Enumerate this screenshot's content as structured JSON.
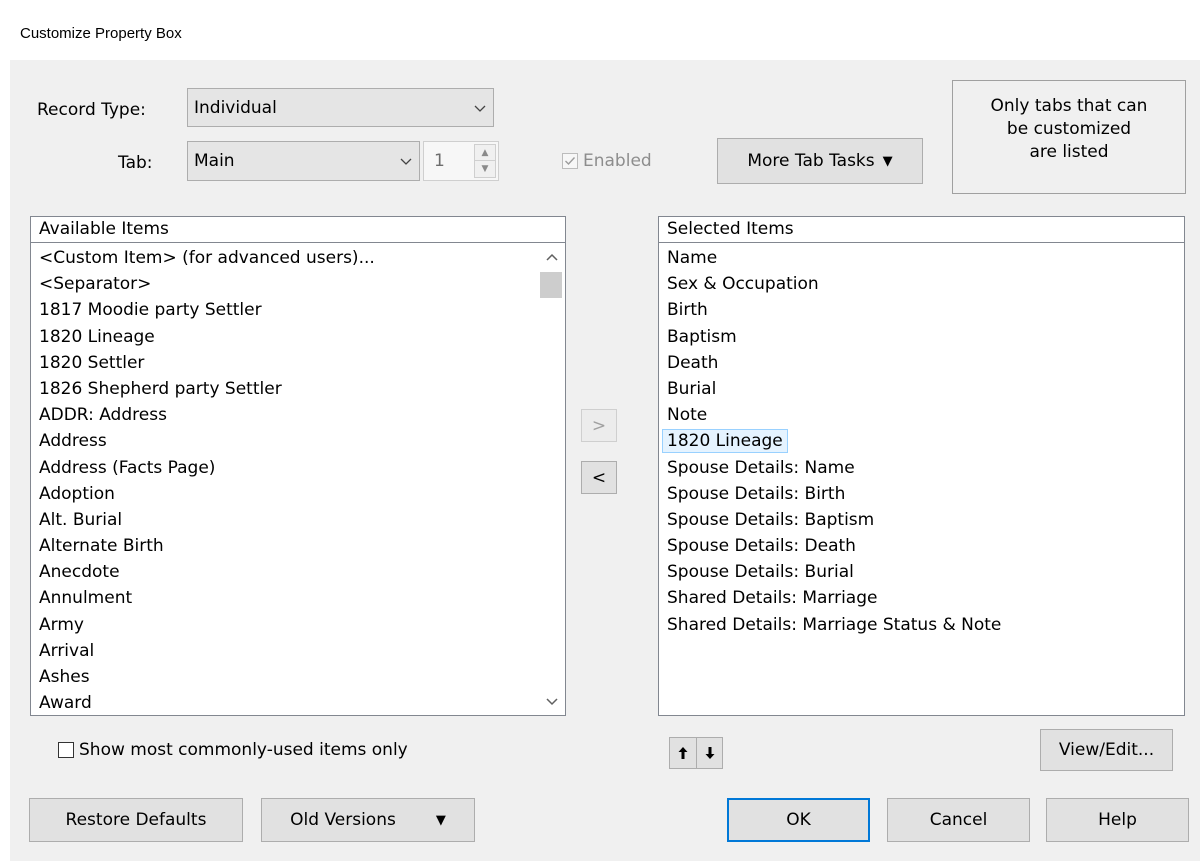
{
  "window": {
    "title": "Customize Property Box"
  },
  "record_type": {
    "label": "Record Type:",
    "value": "Individual"
  },
  "tab": {
    "label": "Tab:",
    "value": "Main",
    "spinner_value": "1"
  },
  "enabled": {
    "label": "Enabled",
    "checked": true,
    "disabled": true
  },
  "more_tab_tasks": {
    "label": "More Tab Tasks"
  },
  "info_note": {
    "line1": "Only tabs that can",
    "line2": "be customized",
    "line3": "are listed"
  },
  "available": {
    "header": "Available Items",
    "items": [
      "<Custom Item> (for advanced users)...",
      "<Separator>",
      "1817 Moodie party Settler",
      "1820 Lineage",
      "1820 Settler",
      "1826 Shepherd party Settler",
      "ADDR: Address",
      "Address",
      "Address (Facts Page)",
      "Adoption",
      "Alt. Burial",
      "Alternate Birth",
      "Anecdote",
      "Annulment",
      "Army",
      "Arrival",
      "Ashes",
      "Award"
    ]
  },
  "move_buttons": {
    "add": ">",
    "remove": "<"
  },
  "selected": {
    "header": "Selected Items",
    "items": [
      "Name",
      "Sex & Occupation",
      "Birth",
      "Baptism",
      "Death",
      "Burial",
      "Note",
      "1820 Lineage",
      "Spouse Details: Name",
      "Spouse Details: Birth",
      "Spouse Details: Baptism",
      "Spouse Details: Death",
      "Spouse Details: Burial",
      "Shared Details: Marriage",
      "Shared Details: Marriage Status & Note"
    ],
    "selected_item": "1820 Lineage"
  },
  "common_only": {
    "label": "Show most commonly-used items only",
    "checked": false
  },
  "buttons": {
    "view_edit": "View/Edit...",
    "restore_defaults": "Restore Defaults",
    "old_versions": "Old Versions",
    "ok": "OK",
    "cancel": "Cancel",
    "help": "Help"
  },
  "colors": {
    "accent": "#0078d7",
    "selection_bg": "#e5f3ff",
    "selection_border": "#99d1ff",
    "dialog_bg": "#f0f0f0"
  }
}
